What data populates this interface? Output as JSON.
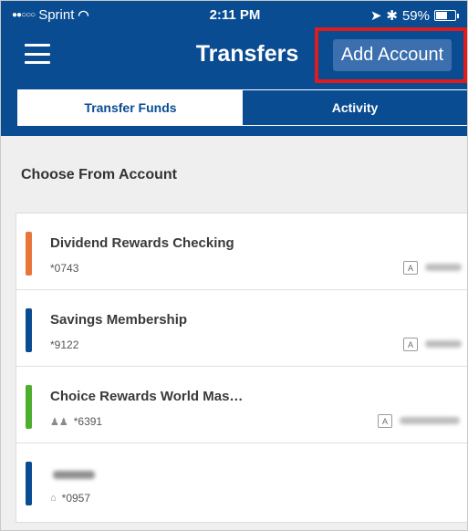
{
  "status_bar": {
    "signal_dots": "●●○○○",
    "carrier": "Sprint",
    "time": "2:11 PM",
    "battery_percent": "59%",
    "battery_level": 0.59,
    "icons": [
      "wifi-icon",
      "location-icon",
      "bluetooth-icon",
      "battery-icon"
    ]
  },
  "header": {
    "title": "Transfers",
    "add_account_label": "Add Account",
    "highlight_color": "#e01b1b",
    "brand_color": "#0a4c92"
  },
  "tabs": [
    {
      "label": "Transfer Funds",
      "active": true
    },
    {
      "label": "Activity",
      "active": false
    }
  ],
  "section_title": "Choose From Account",
  "accounts": [
    {
      "name": "Dividend Rewards Checking",
      "number": "*0743",
      "color": "#e8763a",
      "icon": "",
      "badge": "A"
    },
    {
      "name": "Savings Membership",
      "number": "*9122",
      "color": "#0a4c92",
      "icon": "",
      "badge": "A"
    },
    {
      "name": "Choice Rewards World Mas…",
      "number": "*6391",
      "color": "#4caf2e",
      "icon": "joint-owner-icon",
      "badge": "A"
    },
    {
      "name": "",
      "number": "*0957",
      "color": "#0a4c92",
      "icon": "bank-icon",
      "badge": ""
    }
  ]
}
